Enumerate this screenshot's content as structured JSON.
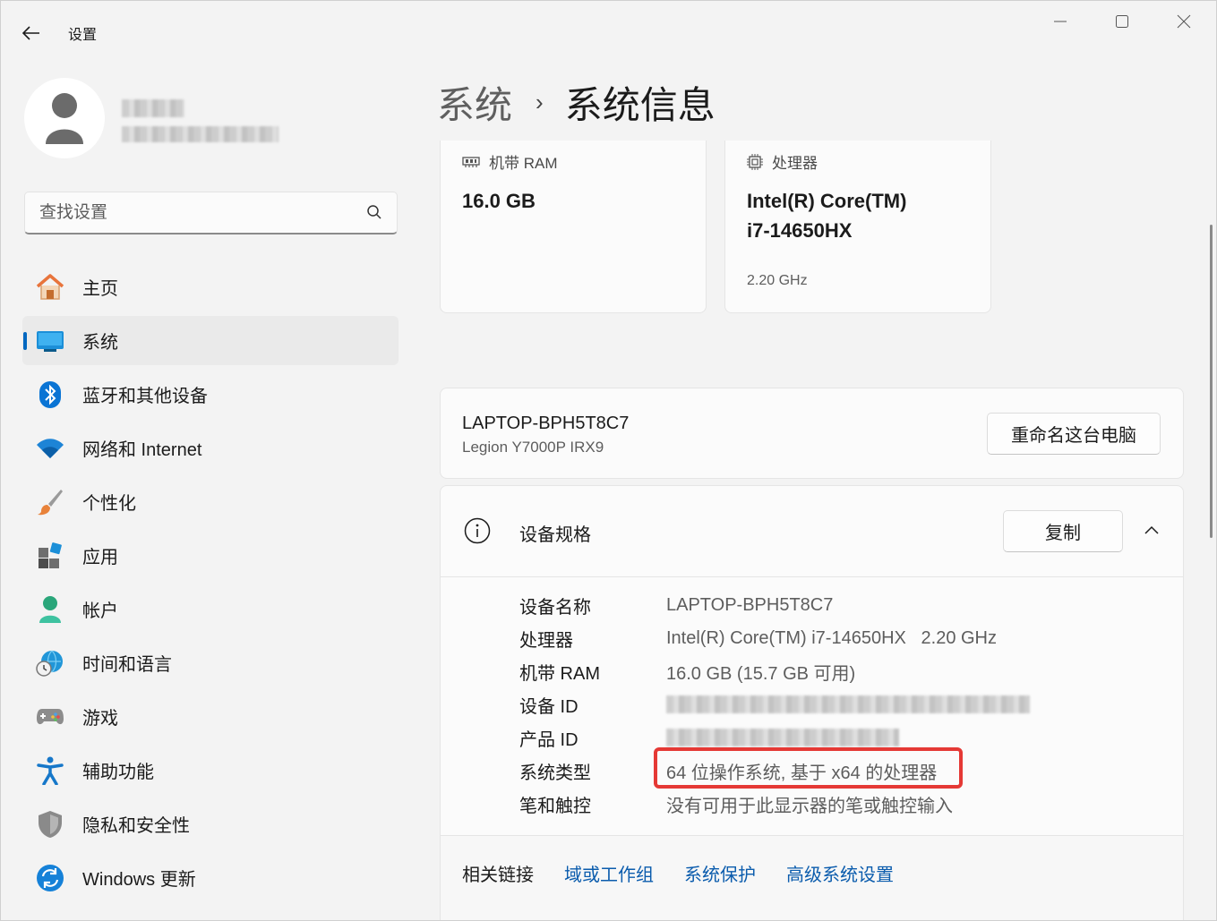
{
  "window": {
    "app_title": "设置",
    "controls": {
      "minimize": "minimize-icon",
      "maximize": "maximize-icon",
      "close": "close-icon"
    }
  },
  "search": {
    "placeholder": "查找设置"
  },
  "sidebar": {
    "items": [
      {
        "label": "主页",
        "icon": "home-icon"
      },
      {
        "label": "系统",
        "icon": "system-icon",
        "active": true
      },
      {
        "label": "蓝牙和其他设备",
        "icon": "bluetooth-icon"
      },
      {
        "label": "网络和 Internet",
        "icon": "wifi-icon"
      },
      {
        "label": "个性化",
        "icon": "brush-icon"
      },
      {
        "label": "应用",
        "icon": "apps-icon"
      },
      {
        "label": "帐户",
        "icon": "account-icon"
      },
      {
        "label": "时间和语言",
        "icon": "globe-clock-icon"
      },
      {
        "label": "游戏",
        "icon": "gamepad-icon"
      },
      {
        "label": "辅助功能",
        "icon": "accessibility-icon"
      },
      {
        "label": "隐私和安全性",
        "icon": "shield-icon"
      },
      {
        "label": "Windows 更新",
        "icon": "update-icon"
      }
    ]
  },
  "header": {
    "parent": "系统",
    "separator": "›",
    "current": "系统信息"
  },
  "top_cards": {
    "ram": {
      "label": "机带 RAM",
      "value": "16.0 GB"
    },
    "cpu": {
      "label": "处理器",
      "line1": "Intel(R) Core(TM)",
      "line2": "i7-14650HX",
      "speed": "2.20 GHz"
    }
  },
  "device": {
    "name": "LAPTOP-BPH5T8C7",
    "model": "Legion Y7000P IRX9",
    "rename_button": "重命名这台电脑"
  },
  "specs": {
    "title": "设备规格",
    "copy_button": "复制",
    "rows": [
      {
        "key": "设备名称",
        "value": "LAPTOP-BPH5T8C7"
      },
      {
        "key": "处理器",
        "value": "Intel(R) Core(TM) i7-14650HX   2.20 GHz"
      },
      {
        "key": "机带 RAM",
        "value": "16.0 GB (15.7 GB 可用)"
      },
      {
        "key": "设备 ID",
        "value": ""
      },
      {
        "key": "产品 ID",
        "value": ""
      },
      {
        "key": "系统类型",
        "value": "64 位操作系统, 基于 x64 的处理器"
      },
      {
        "key": "笔和触控",
        "value": "没有可用于此显示器的笔或触控输入"
      }
    ],
    "highlight_color": "#e53935"
  },
  "related": {
    "label": "相关链接",
    "links": [
      "域或工作组",
      "系统保护",
      "高级系统设置"
    ]
  },
  "colors": {
    "accent": "#0067c0",
    "link": "#0b5cad"
  }
}
